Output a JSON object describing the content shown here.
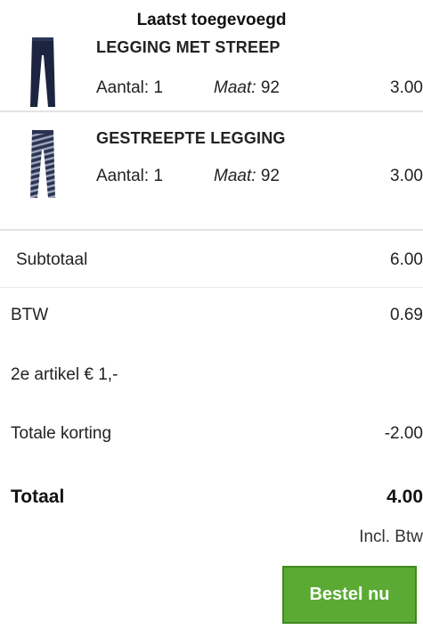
{
  "cart": {
    "heading": "Laatst toegevoegd",
    "items": [
      {
        "title": "LEGGING MET STREEP",
        "quantity_label": "Aantal:",
        "quantity": "1",
        "size_label": "Maat:",
        "size": "92",
        "price": "3.00",
        "image_icon": "navy-legging-icon",
        "image_color": "#1c2440"
      },
      {
        "title": "GESTREEPTE LEGGING",
        "quantity_label": "Aantal:",
        "quantity": "1",
        "size_label": "Maat:",
        "size": "92",
        "price": "3.00",
        "image_icon": "striped-legging-icon",
        "image_color": "#2a3350"
      }
    ]
  },
  "summary": {
    "subtotal_label": "Subtotaal",
    "subtotal_value": "6.00",
    "vat_label": "BTW",
    "vat_value": "0.69",
    "promo_label": "2e artikel € 1,-",
    "discount_label": "Totale korting",
    "discount_value": "-2.00",
    "total_label": "Totaal",
    "total_value": "4.00",
    "incl_vat": "Incl. Btw"
  },
  "actions": {
    "order_label": "Bestel nu",
    "order_color": "#5aaa33"
  }
}
